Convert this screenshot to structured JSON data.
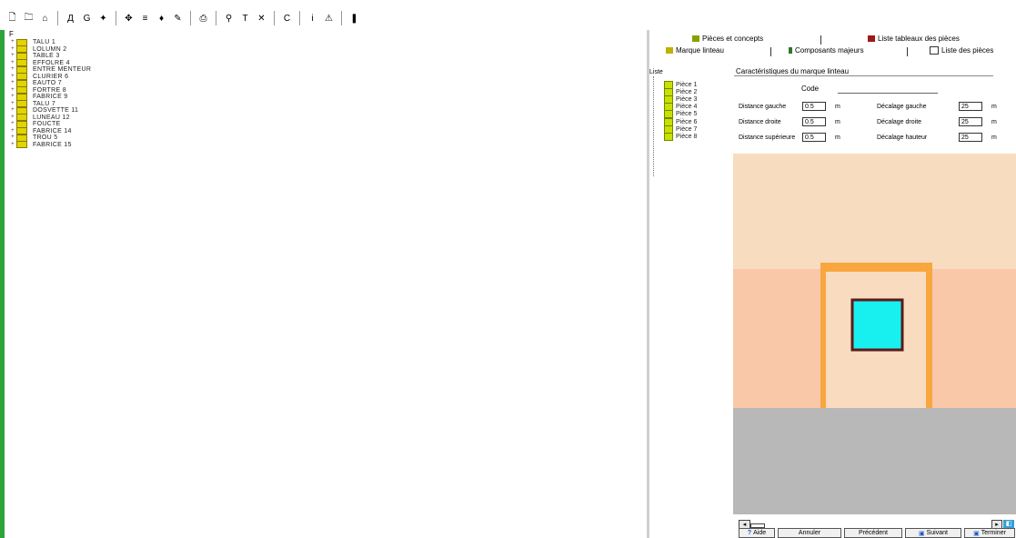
{
  "toolbar": {
    "buttons": [
      {
        "icon": "new-document-icon",
        "glyph": "🗋"
      },
      {
        "icon": "open-folder-icon",
        "glyph": "🗀"
      },
      {
        "icon": "house-icon",
        "glyph": "⌂"
      },
      {
        "sep": true
      },
      {
        "icon": "view-icon",
        "glyph": "Д"
      },
      {
        "icon": "globe-icon",
        "glyph": "G"
      },
      {
        "icon": "pointer-icon",
        "glyph": "✦"
      },
      {
        "sep": true
      },
      {
        "icon": "pan-icon",
        "glyph": "✥"
      },
      {
        "icon": "palette-icon",
        "glyph": "≡"
      },
      {
        "icon": "bucket-icon",
        "glyph": "♦"
      },
      {
        "icon": "brush-icon",
        "glyph": "✎"
      },
      {
        "sep": true
      },
      {
        "icon": "print-icon",
        "glyph": "⎙"
      },
      {
        "sep": true
      },
      {
        "icon": "search-icon",
        "glyph": "⚲"
      },
      {
        "icon": "text-icon",
        "glyph": "T"
      },
      {
        "icon": "delete-icon",
        "glyph": "✕"
      },
      {
        "sep": true
      },
      {
        "icon": "refresh-icon",
        "glyph": "C"
      },
      {
        "sep": true
      },
      {
        "icon": "info-icon",
        "glyph": "i"
      },
      {
        "icon": "warning-icon",
        "glyph": "⚠"
      },
      {
        "sep": true
      },
      {
        "icon": "exit-icon",
        "glyph": "❚"
      }
    ]
  },
  "tree": {
    "root_label": "F",
    "items": [
      "TALU 1",
      "LOLUMN 2",
      "TABLE 3",
      "EFFOLRE 4",
      "ENTRE MENTEUR",
      "CLURIER 6",
      "EAUTO 7",
      "FORTRE 8",
      "FABRICE 9",
      "TALU 7",
      "DOSVETTE 11",
      "LUNEAU 12",
      "FOUCTE",
      "FABRICE 14",
      "TROU 5",
      "FABRICE 15"
    ]
  },
  "tabs": {
    "top_left": "Pièces et concepts",
    "top_right": "Liste tableaux des pièces",
    "bottom_left": "Marque linteau",
    "bottom_mid": "Composants majeurs",
    "bottom_right": "Liste des pièces"
  },
  "subtree": {
    "root_label": "Liste",
    "items": [
      "Pièce 1",
      "Pièce 2",
      "Pièce 3",
      "Pièce 4",
      "Pièce 5",
      "Pièce 6",
      "Pièce 7",
      "Pièce 8"
    ]
  },
  "panel": {
    "group_title": "Caractéristiques du marque linteau",
    "code_label": "Code",
    "rows": [
      {
        "left_label": "Distance gauche",
        "left_value": "0.5",
        "right_label": "Décalage gauche",
        "right_value": "25",
        "unit": "m"
      },
      {
        "left_label": "Distance droite",
        "left_value": "0.5",
        "right_label": "Décalage droite",
        "right_value": "25",
        "unit": "m"
      },
      {
        "left_label": "Distance supérieure",
        "left_value": "0.5",
        "right_label": "Décalage hauteur",
        "right_value": "25",
        "unit": "m"
      }
    ]
  },
  "colors": {
    "wall_top": "#f8dcc0",
    "wall_mid": "#f8c8a8",
    "frame": "#f7a73e",
    "inner": "#f9dcc0",
    "window": "#18f0f0",
    "window_border": "#5a1a1a",
    "floor": "#b8b8b8",
    "left_bar": "#2da33a"
  },
  "buttons": {
    "help": "Aide",
    "cancel": "Annuler",
    "previous": "Précédent",
    "next": "Suivant",
    "finish": "Terminer"
  },
  "scrollbar": {
    "right_label": "◧"
  }
}
